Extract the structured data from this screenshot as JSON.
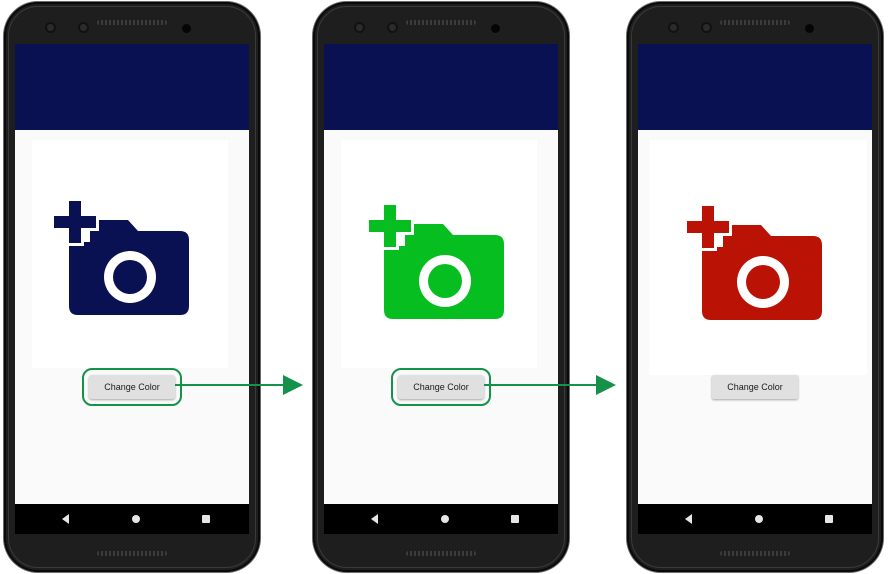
{
  "phones": [
    {
      "button_label": "Change Color",
      "icon_color": "#091153",
      "button_highlighted": true
    },
    {
      "button_label": "Change Color",
      "icon_color": "#07be20",
      "button_highlighted": true
    },
    {
      "button_label": "Change Color",
      "icon_color": "#bb1206",
      "button_highlighted": false
    }
  ],
  "colors": {
    "app_bar": "#091153",
    "highlight_outline": "#14924a",
    "arrow": "#14924a"
  },
  "icons": [
    "add-a-photo-icon",
    "nav-back-icon",
    "nav-home-icon",
    "nav-recent-icon",
    "front-camera-icon"
  ]
}
